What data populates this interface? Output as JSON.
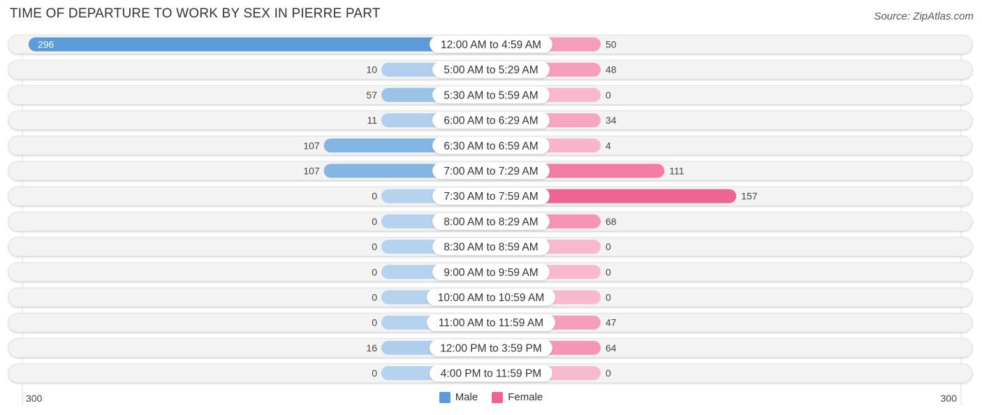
{
  "chart_data": {
    "type": "bar",
    "orientation": "horizontal-diverging",
    "title": "TIME OF DEPARTURE TO WORK BY SEX IN PIERRE PART",
    "source": "Source: ZipAtlas.com",
    "categories": [
      "12:00 AM to 4:59 AM",
      "5:00 AM to 5:29 AM",
      "5:30 AM to 5:59 AM",
      "6:00 AM to 6:29 AM",
      "6:30 AM to 6:59 AM",
      "7:00 AM to 7:29 AM",
      "7:30 AM to 7:59 AM",
      "8:00 AM to 8:29 AM",
      "8:30 AM to 8:59 AM",
      "9:00 AM to 9:59 AM",
      "10:00 AM to 10:59 AM",
      "11:00 AM to 11:59 AM",
      "12:00 PM to 3:59 PM",
      "4:00 PM to 11:59 PM"
    ],
    "series": [
      {
        "name": "Male",
        "color": "#5b9bd9",
        "values": [
          296,
          10,
          57,
          11,
          107,
          107,
          0,
          0,
          0,
          0,
          0,
          0,
          16,
          0
        ]
      },
      {
        "name": "Female",
        "color": "#f06292",
        "values": [
          50,
          48,
          0,
          34,
          4,
          111,
          157,
          68,
          0,
          0,
          0,
          47,
          64,
          0
        ]
      }
    ],
    "xlim": [
      -300,
      300
    ],
    "axis_tick_labels": {
      "left": "300",
      "right": "300"
    },
    "legend": {
      "position": "bottom-center",
      "entries": [
        "Male",
        "Female"
      ]
    },
    "grid": false
  }
}
